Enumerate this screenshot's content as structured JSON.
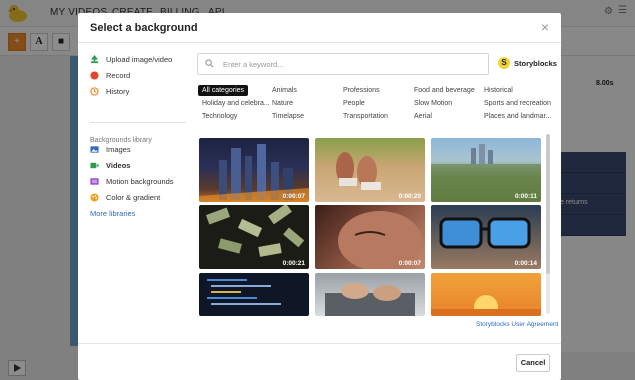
{
  "app": {
    "nav": [
      "MY VIDEOS",
      "CREATE",
      "BILLING",
      "API"
    ],
    "timeline_time": "8.00s",
    "timeline_text": "e returns"
  },
  "modal": {
    "title": "Select a background",
    "close_label": "×",
    "sidebar": {
      "items": [
        {
          "label": "Upload image/video",
          "icon": "upload-icon",
          "color": "#2e9c55"
        },
        {
          "label": "Record",
          "icon": "record-icon",
          "color": "#e0472b"
        },
        {
          "label": "History",
          "icon": "history-icon",
          "color": "#f08a2a"
        }
      ],
      "library_title": "Backgrounds library",
      "library_items": [
        {
          "label": "Images",
          "icon": "image-icon",
          "color": "#2f6bbf"
        },
        {
          "label": "Videos",
          "icon": "video-icon",
          "color": "#2e9c55"
        },
        {
          "label": "Motion backgrounds",
          "icon": "motion-icon",
          "color": "#8b3fd1"
        },
        {
          "label": "Color & gradient",
          "icon": "palette-icon",
          "color": "#f0a020"
        }
      ],
      "more_libraries": "More libraries"
    },
    "search": {
      "placeholder": "Enter a keyword..."
    },
    "provider": {
      "logo": "S",
      "name": "Storyblocks"
    },
    "categories": [
      [
        "All categories",
        "Animals",
        "Professions",
        "Food and beverage",
        "Historical"
      ],
      [
        "Holiday and celebra...",
        "Nature",
        "People",
        "Slow Motion",
        "Sports and recreation"
      ],
      [
        "Technology",
        "Timelapse",
        "Transportation",
        "Aerial",
        "Places and landmar..."
      ]
    ],
    "videos": [
      {
        "duration": "0:00:07",
        "scene": "city-night"
      },
      {
        "duration": "0:00:20",
        "scene": "runner-feet"
      },
      {
        "duration": "0:00:11",
        "scene": "aerial-city"
      },
      {
        "duration": "0:00:21",
        "scene": "falling-money"
      },
      {
        "duration": "0:00:07",
        "scene": "face-closeup"
      },
      {
        "duration": "0:00:14",
        "scene": "glasses-reflection"
      },
      {
        "duration": "",
        "scene": "code-screen"
      },
      {
        "duration": "",
        "scene": "laptop-hands"
      },
      {
        "duration": "",
        "scene": "sunset"
      }
    ],
    "agreement": "Storyblocks User Agreement",
    "cancel": "Cancel"
  }
}
